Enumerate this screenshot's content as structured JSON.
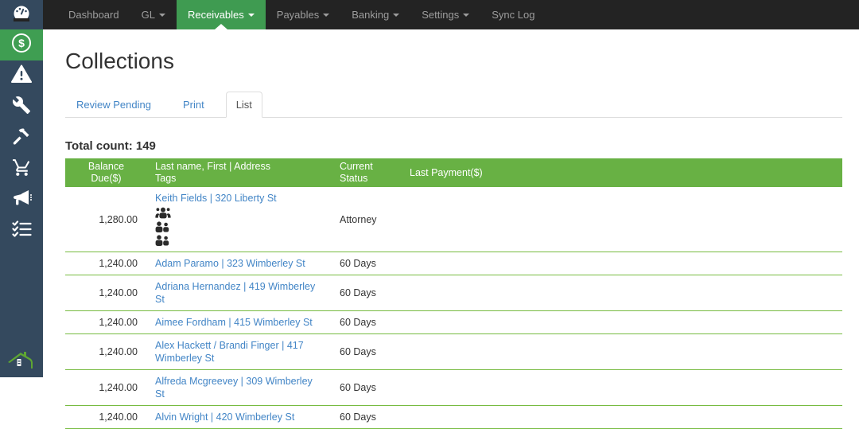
{
  "nav": {
    "brand_icon": "speedometer-icon",
    "items": [
      {
        "label": "Dashboard",
        "dropdown": false,
        "active": false
      },
      {
        "label": "GL",
        "dropdown": true,
        "active": false
      },
      {
        "label": "Receivables",
        "dropdown": true,
        "active": true
      },
      {
        "label": "Payables",
        "dropdown": true,
        "active": false
      },
      {
        "label": "Banking",
        "dropdown": true,
        "active": false
      },
      {
        "label": "Settings",
        "dropdown": true,
        "active": false
      },
      {
        "label": "Sync Log",
        "dropdown": false,
        "active": false
      }
    ]
  },
  "sidebar": {
    "items": [
      {
        "icon": "dollar-circle-icon",
        "active": true
      },
      {
        "icon": "warning-triangle-icon",
        "active": false
      },
      {
        "icon": "wrench-icon",
        "active": false
      },
      {
        "icon": "hammer-icon",
        "active": false
      },
      {
        "icon": "cart-icon",
        "active": false
      },
      {
        "icon": "megaphone-icon",
        "active": false
      },
      {
        "icon": "checklist-icon",
        "active": false
      }
    ],
    "footer_icon": "house-roof-icon"
  },
  "page": {
    "title": "Collections",
    "tabs": [
      {
        "label": "Review Pending",
        "active": false
      },
      {
        "label": "Print",
        "active": false
      },
      {
        "label": "List",
        "active": true
      }
    ],
    "total_count_label": "Total count: 149"
  },
  "table": {
    "columns": {
      "balance": "Balance Due($)",
      "name_line1": "Last name, First | Address",
      "name_line2": "Tags",
      "status": "Current Status",
      "last_payment": "Last Payment($)"
    },
    "rows": [
      {
        "balance": "1,280.00",
        "name": "Keith Fields | 320 Liberty St",
        "status": "Attorney",
        "last_payment": "",
        "tag_icons": [
          "users-group-icon",
          "users-pair-icon",
          "users-pair-icon"
        ]
      },
      {
        "balance": "1,240.00",
        "name": "Adam Paramo | 323 Wimberley St",
        "status": "60 Days",
        "last_payment": "",
        "tag_icons": []
      },
      {
        "balance": "1,240.00",
        "name": "Adriana Hernandez | 419 Wimberley St",
        "status": "60 Days",
        "last_payment": "",
        "tag_icons": []
      },
      {
        "balance": "1,240.00",
        "name": "Aimee Fordham | 415 Wimberley St",
        "status": "60 Days",
        "last_payment": "",
        "tag_icons": []
      },
      {
        "balance": "1,240.00",
        "name": "Alex Hackett / Brandi Finger | 417 Wimberley St",
        "status": "60 Days",
        "last_payment": "",
        "tag_icons": []
      },
      {
        "balance": "1,240.00",
        "name": "Alfreda Mcgreevey | 309 Wimberley St",
        "status": "60 Days",
        "last_payment": "",
        "tag_icons": []
      },
      {
        "balance": "1,240.00",
        "name": "Alvin Wright | 420 Wimberley St",
        "status": "60 Days",
        "last_payment": "",
        "tag_icons": []
      }
    ]
  },
  "colors": {
    "topnav_bg": "#232323",
    "sidebar_bg": "#34495e",
    "active_green": "#3f9b51",
    "table_header_green": "#68b144",
    "row_divider_green": "#77bb41",
    "link_blue": "#4285c6",
    "nav_text_gray": "#9d9d9d",
    "body_text": "#333333"
  }
}
